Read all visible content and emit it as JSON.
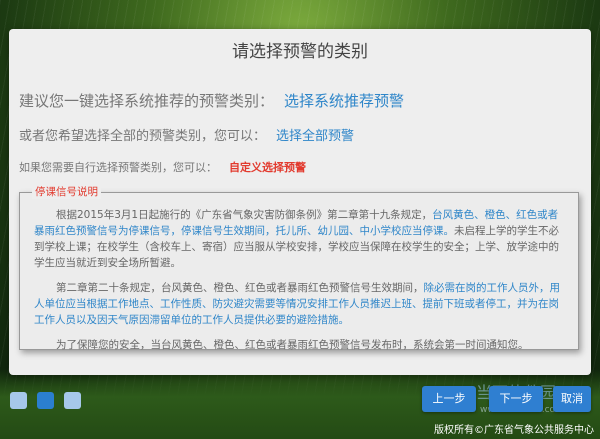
{
  "dialog": {
    "title": "请选择预警的类别",
    "row1_text": "建议您一键选择系统推荐的预警类别：",
    "row1_link": "选择系统推荐预警",
    "row2_text": "或者您希望选择全部的预警类别，您可以：",
    "row2_link": "选择全部预警",
    "row3_text": "如果您需要自行选择预警类别，您可以：",
    "row3_link": "自定义选择预警"
  },
  "notice": {
    "legend": "停课信号说明",
    "p1_a": "根据2015年3月1日起施行的《广东省气象灾害防御条例》第二章第十九条规定，",
    "p1_b": "台风黄色、橙色、红色或者暴雨红色预警信号为停课信号，停课信号生效期间，托儿所、幼儿园、中小学校应当停课。",
    "p1_c": "未启程上学的学生不必到学校上课；在校学生（含校车上、寄宿）应当服从学校安排，学校应当保障在校学生的安全；上学、放学途中的学生应当就近到安全场所暂避。",
    "p2_a": "第二章第二十条规定，台风黄色、橙色、红色或者暴雨红色预警信号生效期间，",
    "p2_b": "除必需在岗的工作人员外，用人单位应当根据工作地点、工作性质、防灾避灾需要等情况安排工作人员推迟上班、提前下班或者停工，并为在岗工作人员以及因天气原因滞留单位的工作人员提供必要的避险措施。",
    "p3": "为了保障您的安全，当台风黄色、橙色、红色或者暴雨红色预警信号发布时，系统会第一时间通知您。"
  },
  "buttons": {
    "prev": "上一步",
    "next": "下一步",
    "cancel": "取消"
  },
  "watermark": {
    "line1": "当下软件园",
    "line2": "www.downxia.com"
  },
  "footer": "版权所有©广东省气象公共服务中心",
  "colors": {
    "accent_blue": "#2f86c9",
    "button_blue": "#2f7fd1",
    "highlight_red": "#e23a2e",
    "panel_bg": "#eeeeee"
  }
}
